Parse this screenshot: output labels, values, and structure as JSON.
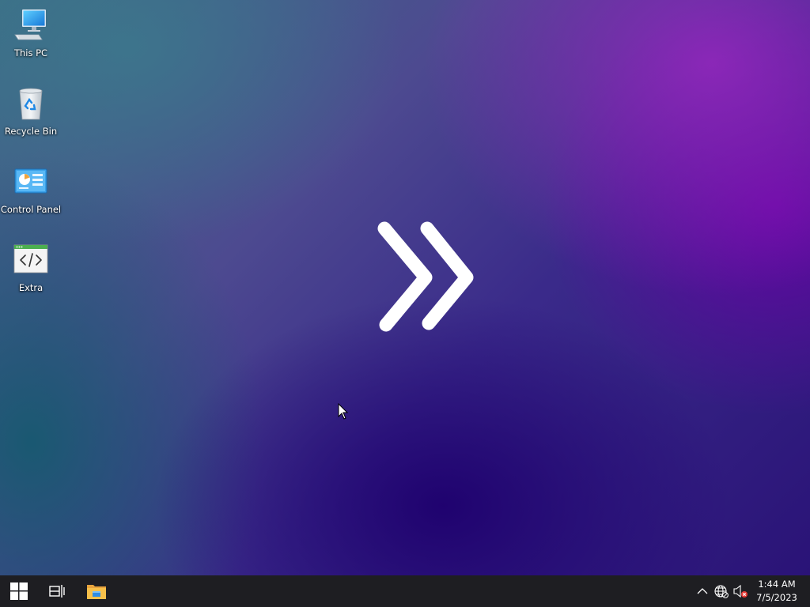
{
  "desktop": {
    "icons": [
      {
        "label": "This PC",
        "icon": "this-pc-icon"
      },
      {
        "label": "Recycle Bin",
        "icon": "recycle-bin-icon"
      },
      {
        "label": "Control Panel",
        "icon": "control-panel-icon"
      },
      {
        "label": "Extra",
        "icon": "code-window-icon"
      }
    ],
    "center_logo": "double-chevron-right-icon"
  },
  "taskbar": {
    "start_icon": "windows-logo-icon",
    "task_view_icon": "task-view-icon",
    "pinned": [
      {
        "name": "File Explorer",
        "icon": "file-explorer-icon"
      }
    ],
    "tray": {
      "icons": [
        "chevron-up-icon",
        "network-globe-icon",
        "speaker-muted-icon"
      ],
      "time": "1:44 AM",
      "date": "7/5/2023"
    }
  },
  "colors": {
    "taskbar_bg": "#1e1e22",
    "accent_purple": "#7a1fb0",
    "icon_label": "#ffffff"
  }
}
